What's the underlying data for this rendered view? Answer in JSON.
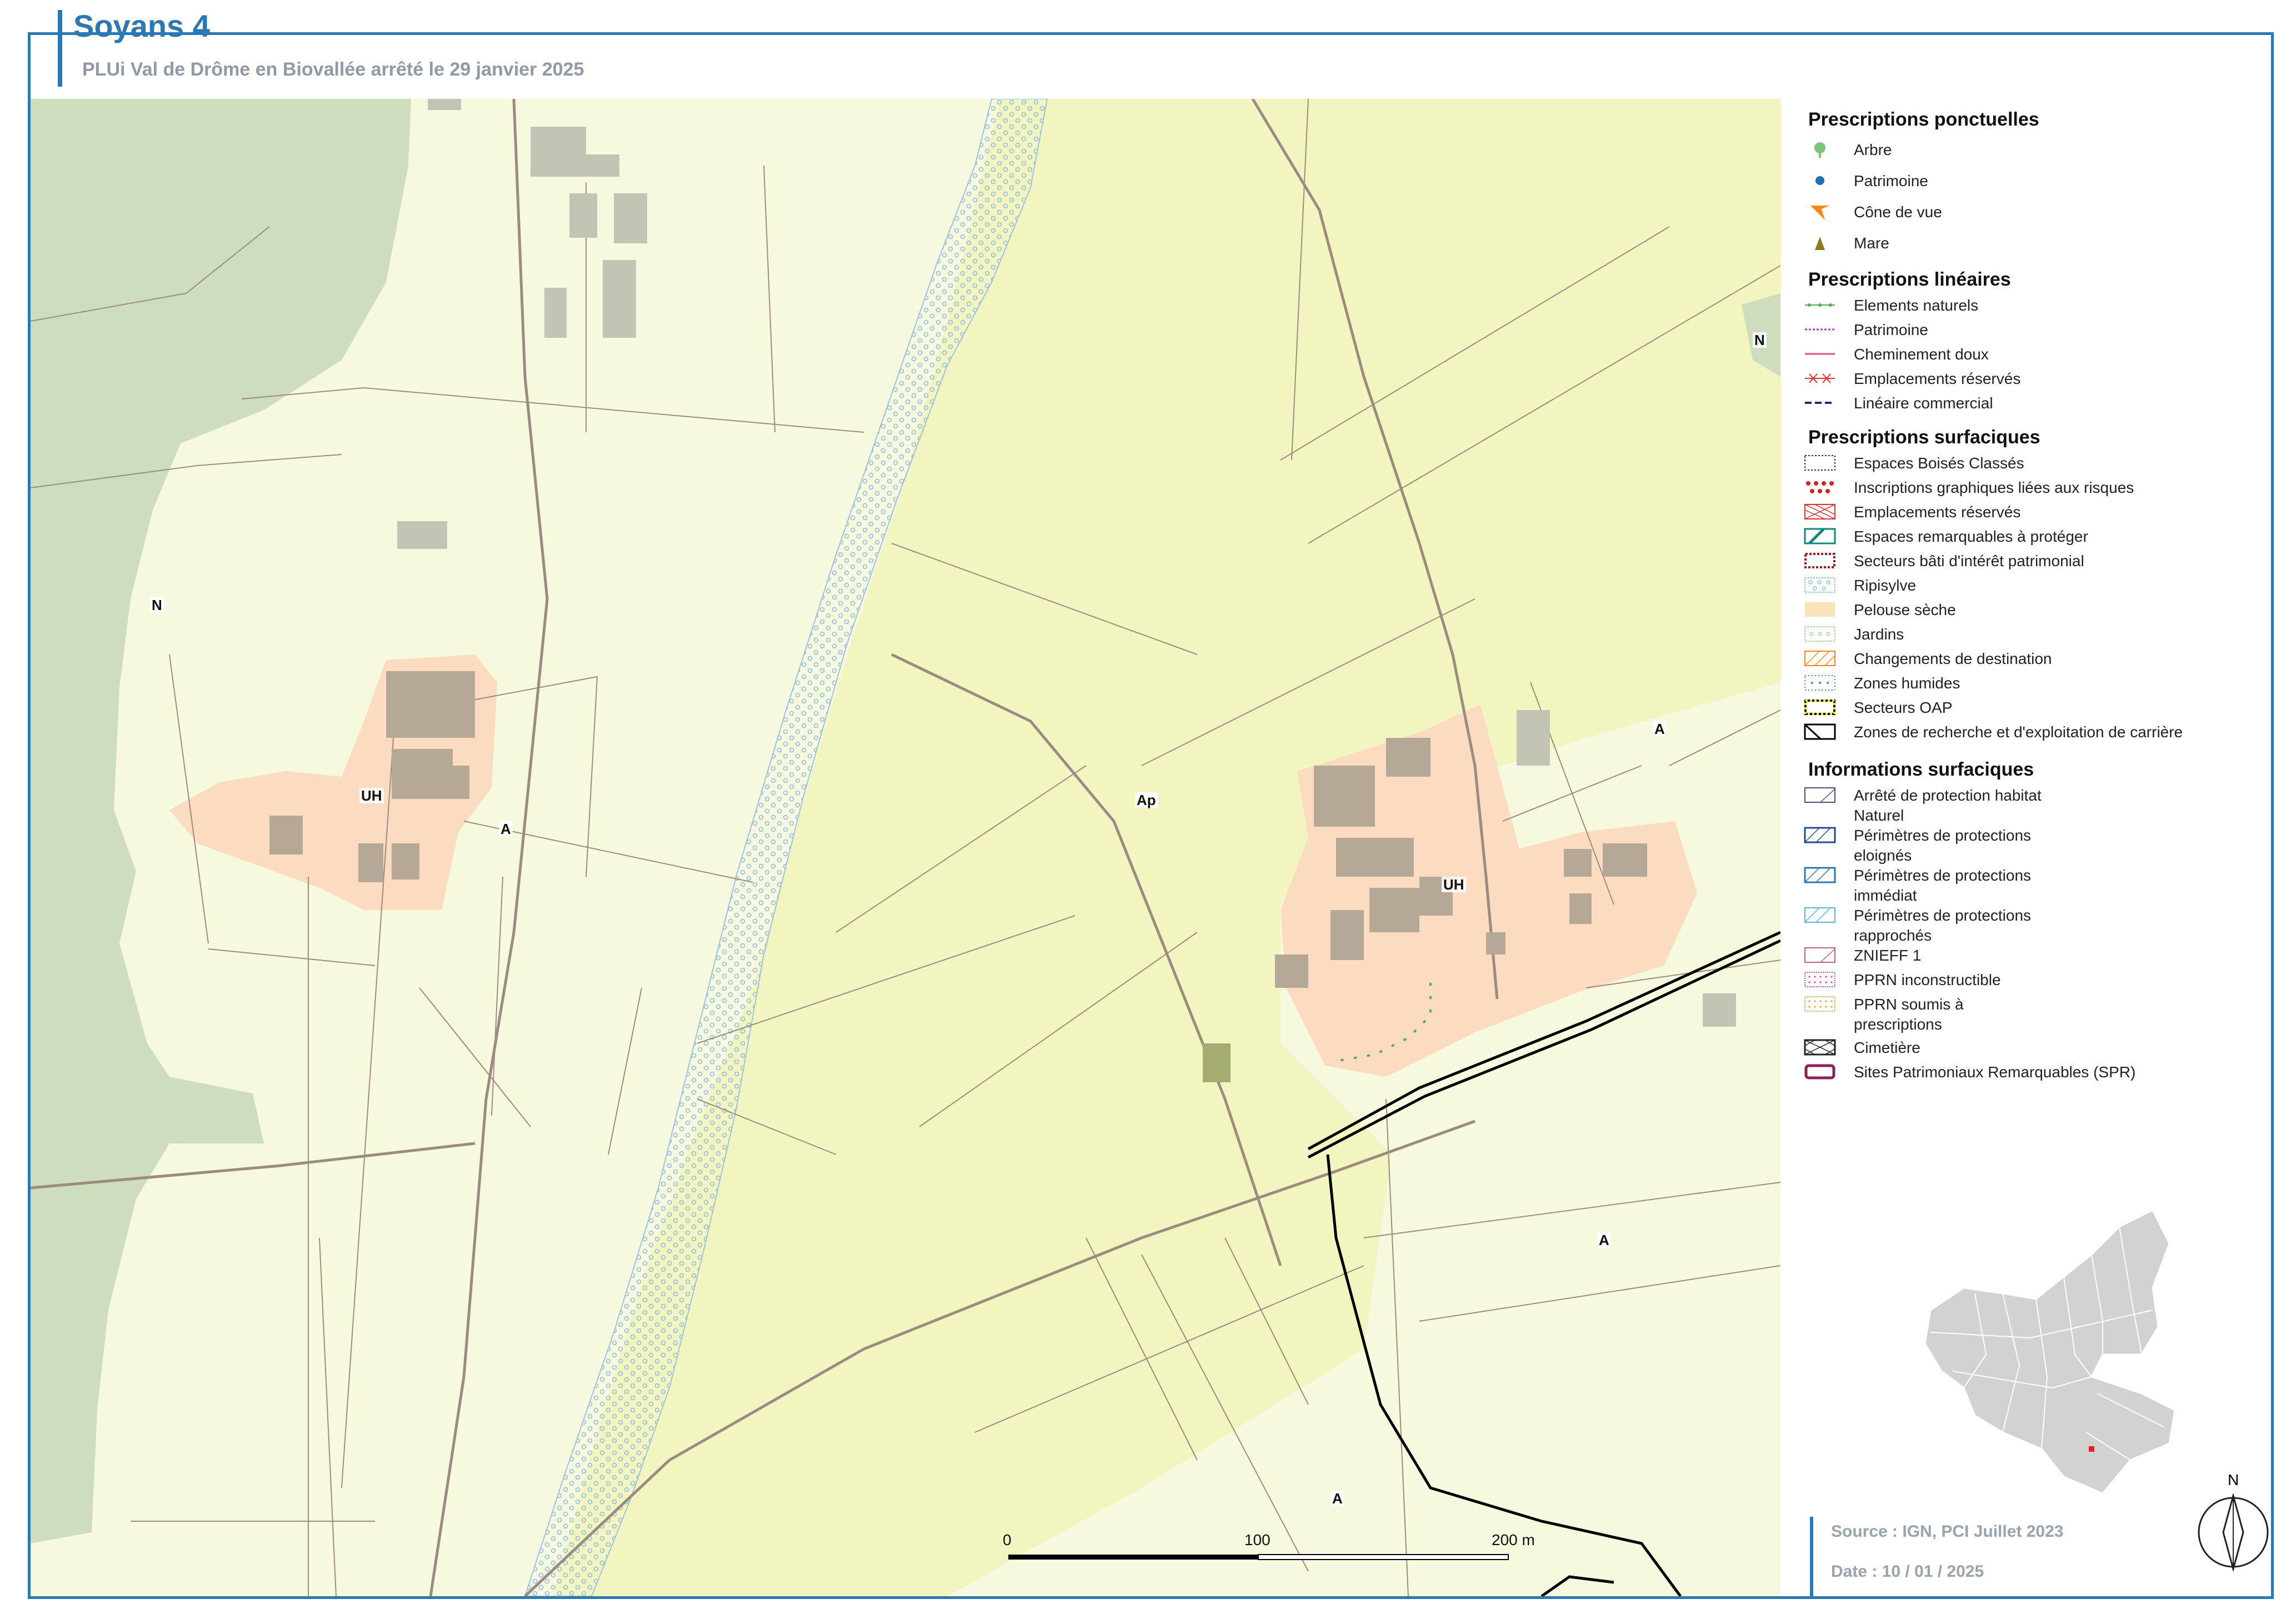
{
  "header": {
    "title": "Soyans 4",
    "subtitle": "PLUi Val de Drôme en Biovallée arrêté le 29 janvier 2025"
  },
  "map": {
    "zone_labels": {
      "n_west": "N",
      "uh_west": "UH",
      "a_west": "A",
      "ap_center": "Ap",
      "uh_east": "UH",
      "a_east_top": "A",
      "a_east_mid": "A",
      "a_south": "A",
      "n_east": "N"
    },
    "scale_bar": {
      "labels": [
        "0",
        "100",
        "200 m"
      ]
    },
    "colors": {
      "zone_n": "#cfddbf",
      "zone_a": "#f7f9df",
      "zone_ap": "#f2f5bf",
      "zone_uh": "#fbdcc0",
      "building": "#b6a896",
      "building_annex": "#c4c4b4",
      "ripisylve": "#9bc4e2",
      "road": "#9c8b80",
      "rail": "#000000",
      "natural_elements": "#4fae4f"
    }
  },
  "legend": {
    "ponctuelles": {
      "title": "Prescriptions ponctuelles",
      "items": [
        {
          "label": "Arbre",
          "icon": "tree-icon",
          "color": "#7cc47a"
        },
        {
          "label": "Patrimoine",
          "icon": "dot-icon",
          "color": "#1f6fae"
        },
        {
          "label": "Cône de vue",
          "icon": "view-cone-icon",
          "color": "#f18a1c"
        },
        {
          "label": "Mare",
          "icon": "triangle-icon",
          "color": "#8b7a1e"
        }
      ]
    },
    "lineaires": {
      "title": "Prescriptions linéaires",
      "items": [
        {
          "label": "Elements naturels",
          "color": "#4fae4f"
        },
        {
          "label": "Patrimoine",
          "color": "#b43cb4"
        },
        {
          "label": "Cheminement doux",
          "color": "#e0507a"
        },
        {
          "label": "Emplacements réservés",
          "color": "#e03030"
        },
        {
          "label": "Linéaire commercial",
          "color": "#2a2a6a"
        }
      ]
    },
    "surfaciques": {
      "title": "Prescriptions surfaciques",
      "items": [
        {
          "label": "Espaces Boisés Classés"
        },
        {
          "label": "Inscriptions graphiques liées aux risques"
        },
        {
          "label": "Emplacements réservés"
        },
        {
          "label": "Espaces remarquables à protéger"
        },
        {
          "label": "Secteurs bâti d'intérêt patrimonial"
        },
        {
          "label": "Ripisylve"
        },
        {
          "label": "Pelouse sèche"
        },
        {
          "label": "Jardins"
        },
        {
          "label": "Changements de destination"
        },
        {
          "label": "Zones humides"
        },
        {
          "label": "Secteurs OAP"
        },
        {
          "label": "Zones de recherche et d'exploitation de carrière"
        }
      ]
    },
    "informations": {
      "title": "Informations surfaciques",
      "items": [
        {
          "label": "Arrêté de protection habitat Naturel"
        },
        {
          "label": "Périmètres de protections eloignés"
        },
        {
          "label": "Périmètres de protections immédiat"
        },
        {
          "label": "Périmètres de protections rapprochés"
        },
        {
          "label": "ZNIEFF 1"
        },
        {
          "label": "PPRN inconstructible"
        },
        {
          "label": "PPRN soumis à prescriptions"
        },
        {
          "label": "Cimetière"
        },
        {
          "label": "Sites Patrimoniaux Remarquables (SPR)"
        }
      ]
    }
  },
  "footer": {
    "source": "Source : IGN, PCI Juillet 2023",
    "date": "Date : 10 / 01 / 2025"
  },
  "north_arrow": "N"
}
